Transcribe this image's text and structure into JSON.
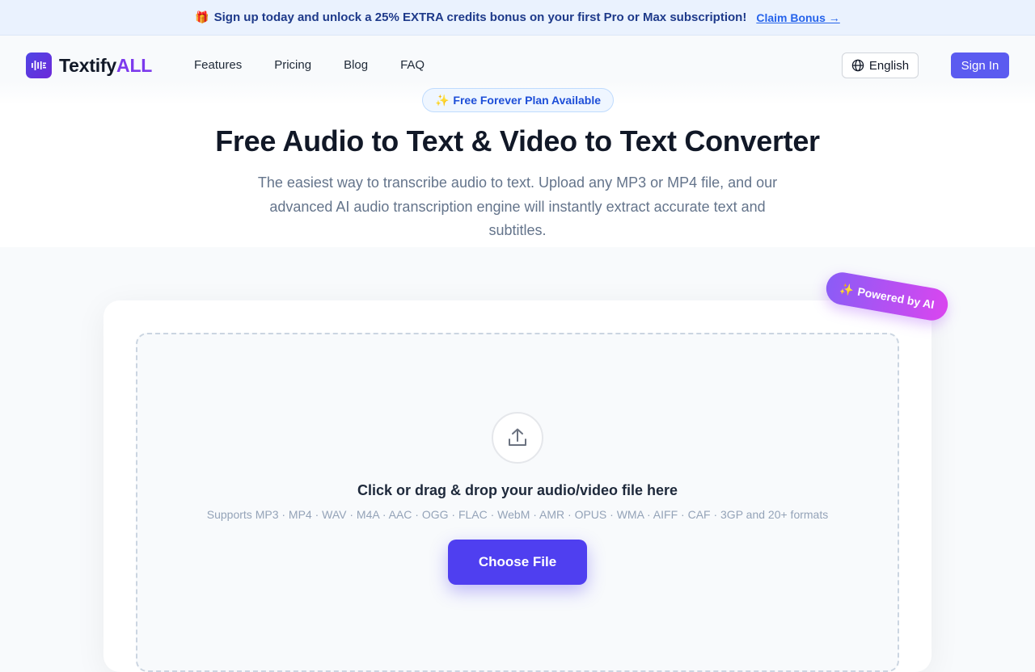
{
  "promo": {
    "gift_icon": "🎁",
    "text": "Sign up today and unlock a 25% EXTRA credits bonus on your first Pro or Max subscription!",
    "link_label": "Claim Bonus →"
  },
  "header": {
    "logo": {
      "name_main": "Textify",
      "name_accent": "ALL",
      "icon": "waveform-icon"
    },
    "nav": [
      {
        "label": "Features"
      },
      {
        "label": "Pricing"
      },
      {
        "label": "Blog"
      },
      {
        "label": "FAQ"
      }
    ],
    "language": {
      "label": "English",
      "icon": "globe-icon"
    },
    "signin_label": "Sign In"
  },
  "hero": {
    "badge_icon": "✨",
    "badge_label": "Free Forever Plan Available",
    "title": "Free Audio to Text & Video to Text Converter",
    "subtitle": "The easiest way to transcribe audio to text. Upload any MP3 or MP4 file, and our advanced AI audio transcription engine will instantly extract accurate text and subtitles."
  },
  "uploader": {
    "ribbon_icon": "✨",
    "ribbon_label": "Powered by AI",
    "upload_icon": "upload-icon",
    "drop_title": "Click or drag & drop your audio/video file here",
    "formats": "Supports MP3 · MP4 · WAV · M4A · AAC · OGG · FLAC · WebM · AMR · OPUS · WMA · AIFF · CAF · 3GP and 20+ formats",
    "choose_label": "Choose File"
  },
  "colors": {
    "brand": "#4f3ff0",
    "accent": "#7c3aed",
    "promo_bg": "#eaf2fe",
    "ribbon_from": "#8b5cf6",
    "ribbon_to": "#d946ef"
  }
}
